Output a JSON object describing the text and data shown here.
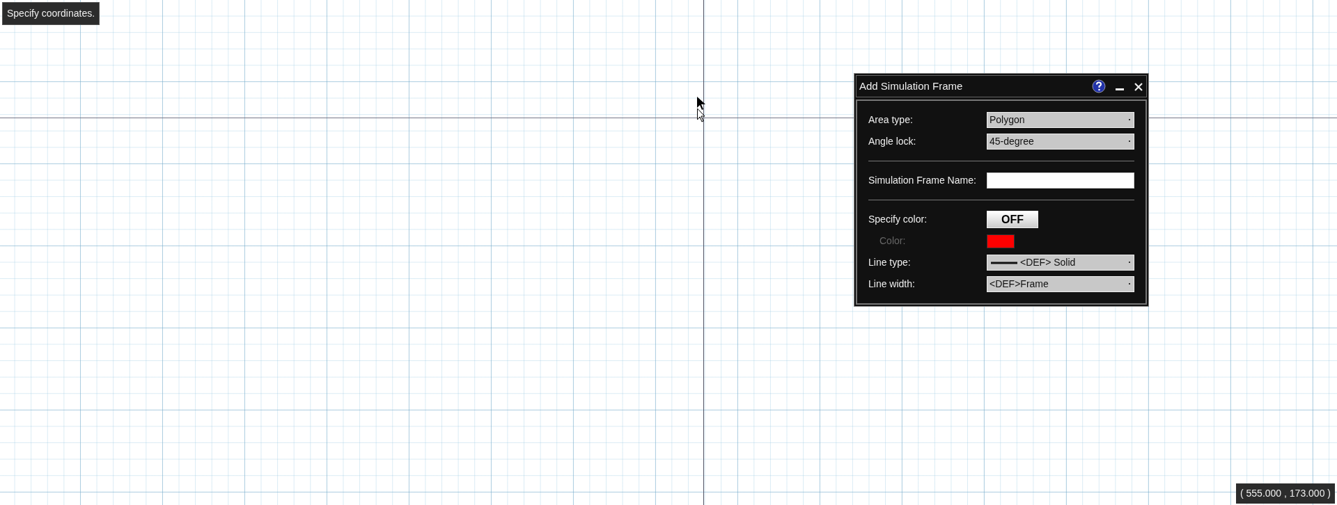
{
  "prompt": "Specify coordinates.",
  "dialog": {
    "title": "Add Simulation Frame",
    "rows": [
      {
        "kind": "select",
        "label": "Area type:",
        "value": "Polygon",
        "disabled": false
      },
      {
        "kind": "select",
        "label": "Angle lock:",
        "value": "45-degree",
        "disabled": false
      },
      {
        "kind": "divider"
      },
      {
        "kind": "text",
        "label": "Simulation Frame Name:",
        "value": "",
        "disabled": false
      },
      {
        "kind": "divider"
      },
      {
        "kind": "toggle",
        "label": "Specify color:",
        "value": "OFF",
        "on": false,
        "disabled": false
      },
      {
        "kind": "color",
        "label": "Color:",
        "color": "#ff0000",
        "disabled": true
      },
      {
        "kind": "linetype",
        "label": "Line type:",
        "value": "<DEF> Solid",
        "disabled": false
      },
      {
        "kind": "select",
        "label": "Line width:",
        "value": "<DEF>Frame",
        "disabled": false
      }
    ]
  },
  "coordinates": "( 555.000 , 173.000 )"
}
